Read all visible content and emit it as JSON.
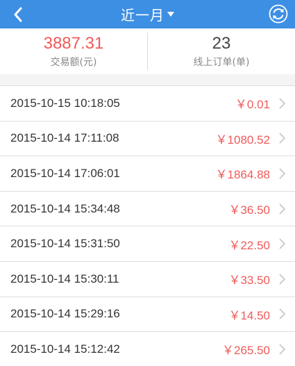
{
  "header": {
    "title": "近一月"
  },
  "summary": {
    "amount_value": "3887.31",
    "amount_label": "交易额(元)",
    "count_value": "23",
    "count_label": "线上订单(单)"
  },
  "orders": [
    {
      "time": "2015-10-15 10:18:05",
      "amount": "￥0.01"
    },
    {
      "time": "2015-10-14 17:11:08",
      "amount": "￥1080.52"
    },
    {
      "time": "2015-10-14 17:06:01",
      "amount": "￥1864.88"
    },
    {
      "time": "2015-10-14 15:34:48",
      "amount": "￥36.50"
    },
    {
      "time": "2015-10-14 15:31:50",
      "amount": "￥22.50"
    },
    {
      "time": "2015-10-14 15:30:11",
      "amount": "￥33.50"
    },
    {
      "time": "2015-10-14 15:29:16",
      "amount": "￥14.50"
    },
    {
      "time": "2015-10-14 15:12:42",
      "amount": "￥265.50"
    }
  ],
  "colors": {
    "header_bg": "#3d8fe3",
    "amount": "#f05a5a"
  }
}
